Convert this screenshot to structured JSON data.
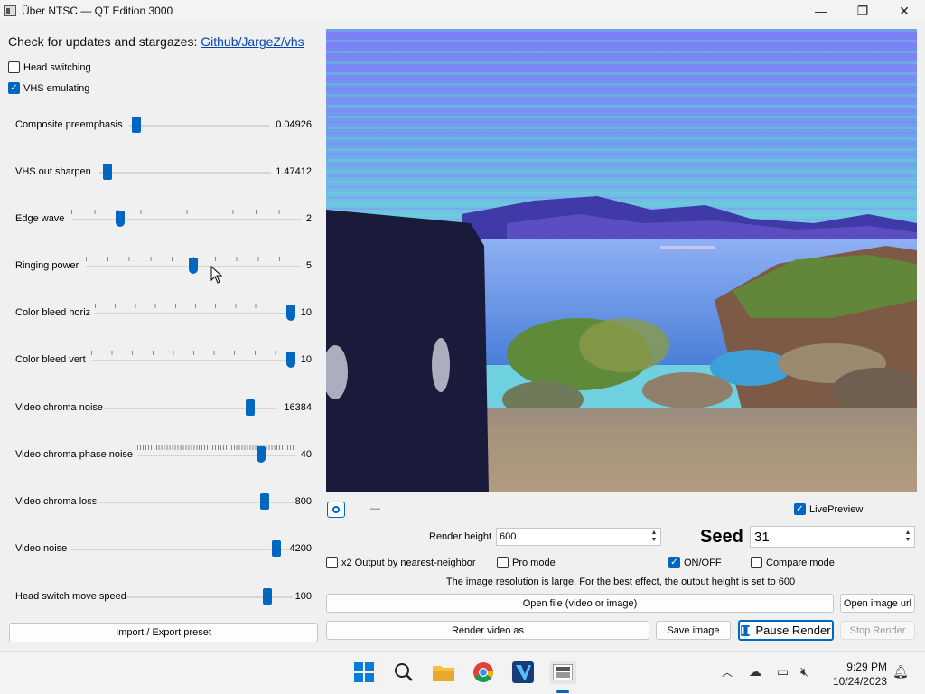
{
  "window": {
    "title": "Über NTSC — QT Edition 3000",
    "minimize": "—",
    "maximize": "❐",
    "close": "✕"
  },
  "left": {
    "updates_text": "Check for updates and stargazes: ",
    "updates_link": "Github/JargeZ/vhs",
    "head_switching": {
      "label": "Head switching",
      "checked": false
    },
    "vhs_emulating": {
      "label": "VHS emulating",
      "checked": true
    },
    "sliders": [
      {
        "label": "Composite preemphasis",
        "value": "0.04926",
        "level": 0.02
      },
      {
        "label": "VHS out sharpen",
        "value": "1.47412",
        "level": 0.02
      },
      {
        "label": "Edge wave",
        "value": "2",
        "level": 0.2
      },
      {
        "label": "Ringing power",
        "value": "5",
        "level": 0.5
      },
      {
        "label": "Color bleed horiz",
        "value": "10",
        "level": 1.0
      },
      {
        "label": "Color bleed vert",
        "value": "10",
        "level": 1.0
      },
      {
        "label": "Video chroma noise",
        "value": "16384",
        "level": 0.86
      },
      {
        "label": "Video chroma phase noise",
        "value": "40",
        "level": 0.8
      },
      {
        "label": "Video chroma loss",
        "value": "800",
        "level": 0.87
      },
      {
        "label": "Video noise",
        "value": "4200",
        "level": 0.88
      },
      {
        "label": "Head switch move speed",
        "value": "100",
        "level": 0.87
      }
    ],
    "preset_button": "Import / Export preset"
  },
  "controls": {
    "live_preview": {
      "label": "LivePreview",
      "checked": true
    },
    "render_height_label": "Render height",
    "render_height_value": "600",
    "seed_label": "Seed",
    "seed_value": "31",
    "x2_output": {
      "label": "x2 Output by nearest-neighbor",
      "checked": false
    },
    "pro_mode": {
      "label": "Pro mode",
      "checked": false
    },
    "on_off": {
      "label": "ON/OFF",
      "checked": true
    },
    "compare_mode": {
      "label": "Compare mode",
      "checked": false
    },
    "info_text": "The image resolution is large. For the best effect, the output height is set to 600",
    "open_file": "Open file (video or image)",
    "open_url": "Open image url",
    "render_video": "Render video as",
    "save_image": "Save image",
    "pause_render": "Pause Render",
    "stop_render": "Stop Render",
    "progress_dash": "—"
  },
  "taskbar": {
    "time": "9:29 PM",
    "date": "10/24/2023",
    "apps": [
      "start-icon",
      "search-icon",
      "file-explorer-icon",
      "chrome-icon",
      "editor-icon",
      "ntsc-app-icon"
    ]
  },
  "colors": {
    "accent": "#0067c0",
    "link": "#0645ad"
  }
}
